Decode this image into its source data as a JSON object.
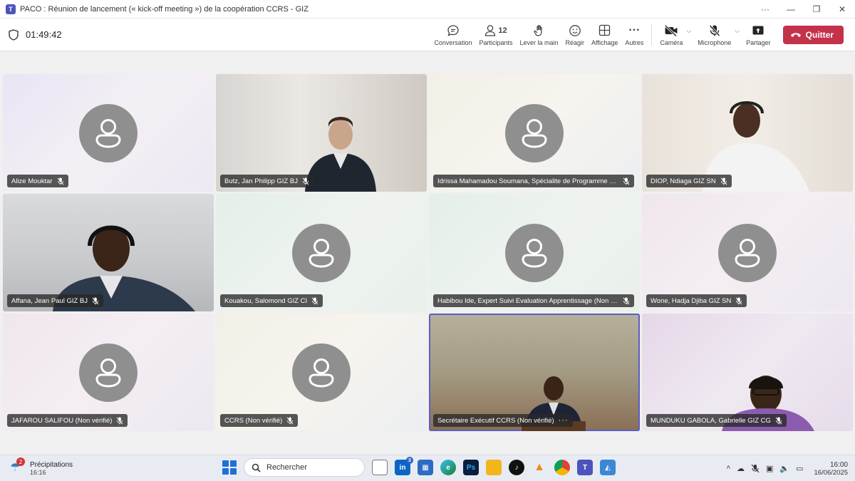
{
  "window": {
    "title": "PACO : Réunion de lancement (« kick-off meeting ») de la coopération CCRS - GIZ",
    "more_icon": "more-dots-icon",
    "minimize_icon": "minimize-icon",
    "restore_icon": "restore-icon",
    "close_icon": "close-icon"
  },
  "meeting": {
    "timer": "01:49:42",
    "participants_count": "12",
    "buttons": {
      "conversation": "Conversation",
      "participants": "Participants",
      "raise_hand": "Lever la main",
      "react": "Réagir",
      "view": "Affichage",
      "more": "Autres",
      "camera": "Caméra",
      "microphone": "Microphone",
      "share": "Partager",
      "leave": "Quitter"
    }
  },
  "tiles": [
    {
      "name": "Alize Mouktar",
      "has_video": false
    },
    {
      "name": "Butz, Jan Philipp GIZ BJ",
      "has_video": true
    },
    {
      "name": "Idrissa Mahamadou Soumana, Spécialite de Programme C...",
      "has_video": false
    },
    {
      "name": "DIOP, Ndiaga GIZ SN",
      "has_video": true
    },
    {
      "name": "Affana, Jean Paul GIZ BJ",
      "has_video": true
    },
    {
      "name": "Kouakou, Salomond GIZ CI",
      "has_video": false
    },
    {
      "name": "Habibou Ide, Expert Suivi Evaluation Apprentissage (Non v...",
      "has_video": false
    },
    {
      "name": "Wone, Hadja Djiba GIZ SN",
      "has_video": false
    },
    {
      "name": "JAFAROU SALIFOU (Non vérifié)",
      "has_video": false
    },
    {
      "name": "CCRS (Non vérifié)",
      "has_video": false
    },
    {
      "name": "Secrétaire Exécutif CCRS (Non vérifié)",
      "has_video": true,
      "active_speaker": true
    },
    {
      "name": "MUNDUKU GABOLA, Gabrielle GIZ CG",
      "has_video": true
    }
  ],
  "taskbar": {
    "weather_label": "Précipitations",
    "weather_sub": "16:16",
    "weather_badge": "2",
    "search_placeholder": "Rechercher",
    "linkedin_badge": "3",
    "time": "16:00",
    "date": "16/06/2025"
  },
  "colors": {
    "accent": "#5b5fc7",
    "leave": "#c4314b"
  }
}
